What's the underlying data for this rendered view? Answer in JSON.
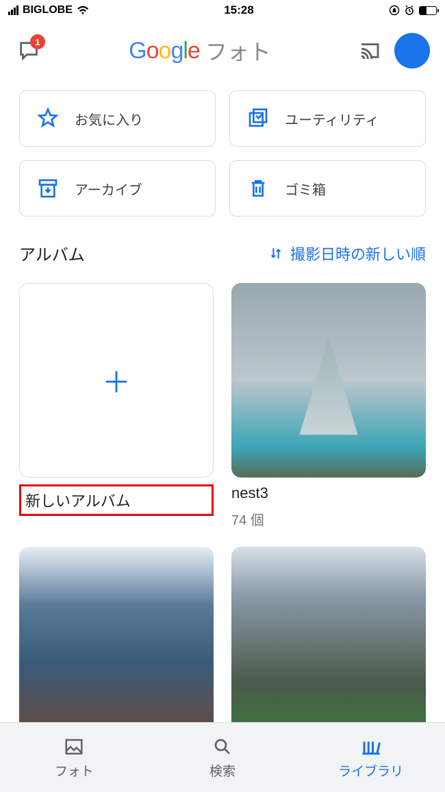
{
  "status": {
    "carrier": "BIGLOBE",
    "time": "15:28"
  },
  "header": {
    "chat_badge": "1",
    "logo_chars": [
      "G",
      "o",
      "o",
      "g",
      "l",
      "e"
    ],
    "app_name": "フォト"
  },
  "categories": [
    {
      "icon": "star",
      "label": "お気に入り"
    },
    {
      "icon": "utility",
      "label": "ユーティリティ"
    },
    {
      "icon": "archive",
      "label": "アーカイブ"
    },
    {
      "icon": "trash",
      "label": "ゴミ箱"
    }
  ],
  "albums": {
    "section_title": "アルバム",
    "sort_label": "撮影日時の新しい順",
    "new_album_label": "新しいアルバム",
    "items": [
      {
        "title": "nest3",
        "count": "74 個",
        "thumb": "monument"
      }
    ]
  },
  "extra_thumbs": [
    "city",
    "mountain"
  ],
  "nav": [
    {
      "label": "フォト",
      "icon": "photo",
      "active": false
    },
    {
      "label": "検索",
      "icon": "search",
      "active": false
    },
    {
      "label": "ライブラリ",
      "icon": "library",
      "active": true
    }
  ]
}
